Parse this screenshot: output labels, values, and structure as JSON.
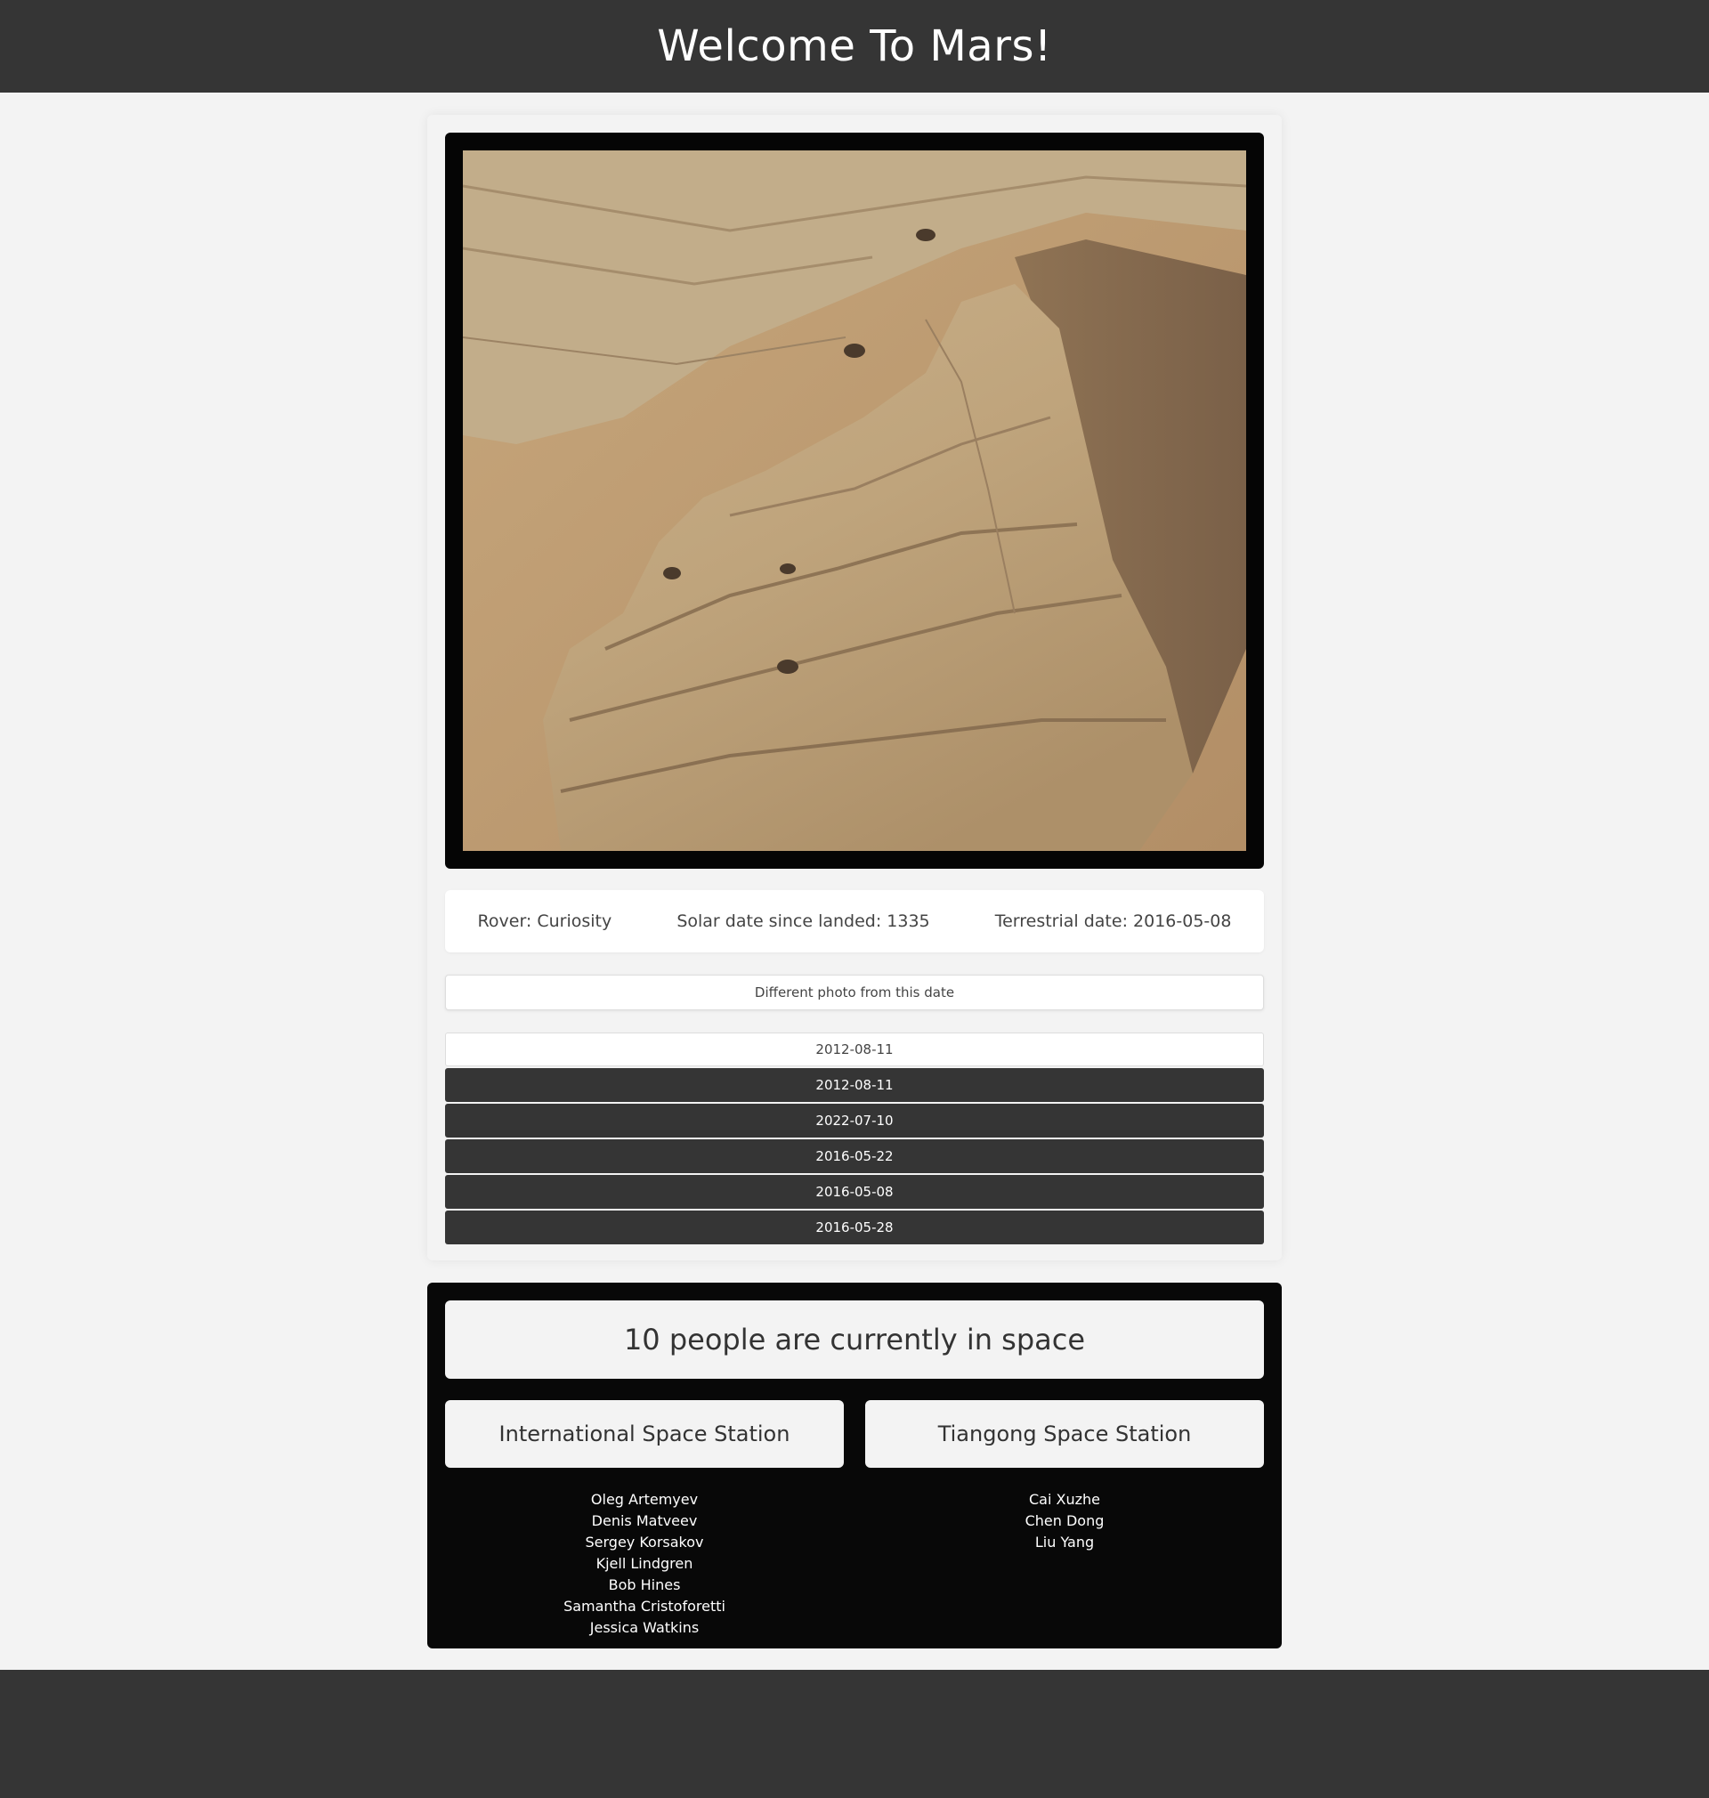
{
  "header": {
    "title": "Welcome To Mars!"
  },
  "mars": {
    "photo_alt": "Mars rover photo of layered rock outcrop",
    "rover_label": "Rover: Curiosity",
    "sol_label": "Solar date since landed: 1335",
    "earth_date_label": "Terrestrial date: 2016-05-08",
    "different_photo_label": "Different photo from this date",
    "dates": [
      "2012-08-11",
      "2012-08-11",
      "2022-07-10",
      "2016-05-22",
      "2016-05-08",
      "2016-05-28"
    ]
  },
  "space": {
    "headline": "10 people are currently in space",
    "stations": [
      {
        "name": "International Space Station",
        "crew": [
          "Oleg Artemyev",
          "Denis Matveev",
          "Sergey Korsakov",
          "Kjell Lindgren",
          "Bob Hines",
          "Samantha Cristoforetti",
          "Jessica Watkins"
        ]
      },
      {
        "name": "Tiangong Space Station",
        "crew": [
          "Cai Xuzhe",
          "Chen Dong",
          "Liu Yang"
        ]
      }
    ]
  },
  "colors": {
    "header_bg": "#353535",
    "page_bg": "#f3f3f3",
    "dark_button": "#353535",
    "space_panel": "#080808"
  }
}
